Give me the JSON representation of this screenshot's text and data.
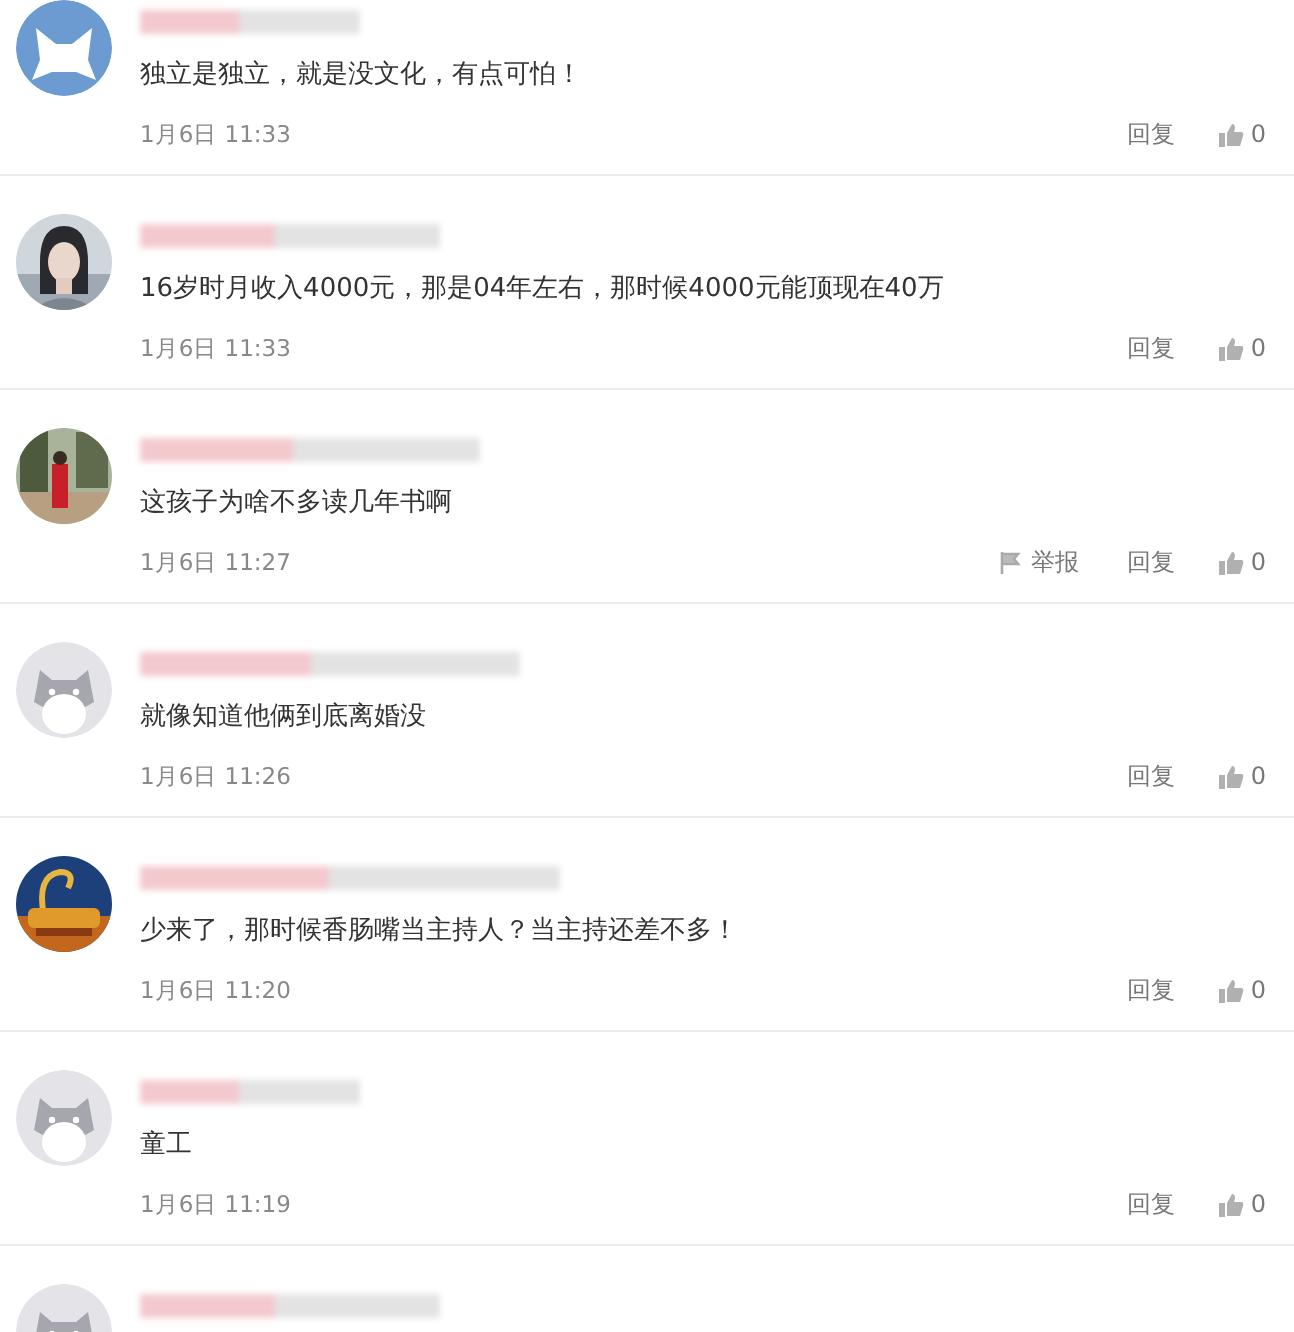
{
  "comments": [
    {
      "avatar": {
        "kind": "default-blue"
      },
      "text": "独立是独立，就是没文化，有点可怕！",
      "time": "1月6日 11:33",
      "reply": "回复",
      "likes": "0"
    },
    {
      "text": "16岁时月收入4000元，那是04年左右，那时候4000元能顶现在40万",
      "time": "1月6日 11:33",
      "reply": "回复",
      "likes": "0"
    },
    {
      "text": "这孩子为啥不多读几年书啊",
      "time": "1月6日 11:27",
      "report": "举报",
      "reply": "回复",
      "likes": "0"
    },
    {
      "avatar": {
        "kind": "default-gray"
      },
      "text": "就像知道他俩到底离婚没",
      "time": "1月6日 11:26",
      "reply": "回复",
      "likes": "0"
    },
    {
      "text": "少来了，那时候香肠嘴当主持人？当主持还差不多！",
      "time": "1月6日 11:20",
      "reply": "回复",
      "likes": "0"
    },
    {
      "avatar": {
        "kind": "default-gray"
      },
      "text": "童工",
      "time": "1月6日 11:19",
      "reply": "回复",
      "likes": "0"
    },
    {
      "avatar": {
        "kind": "default-gray"
      }
    }
  ]
}
